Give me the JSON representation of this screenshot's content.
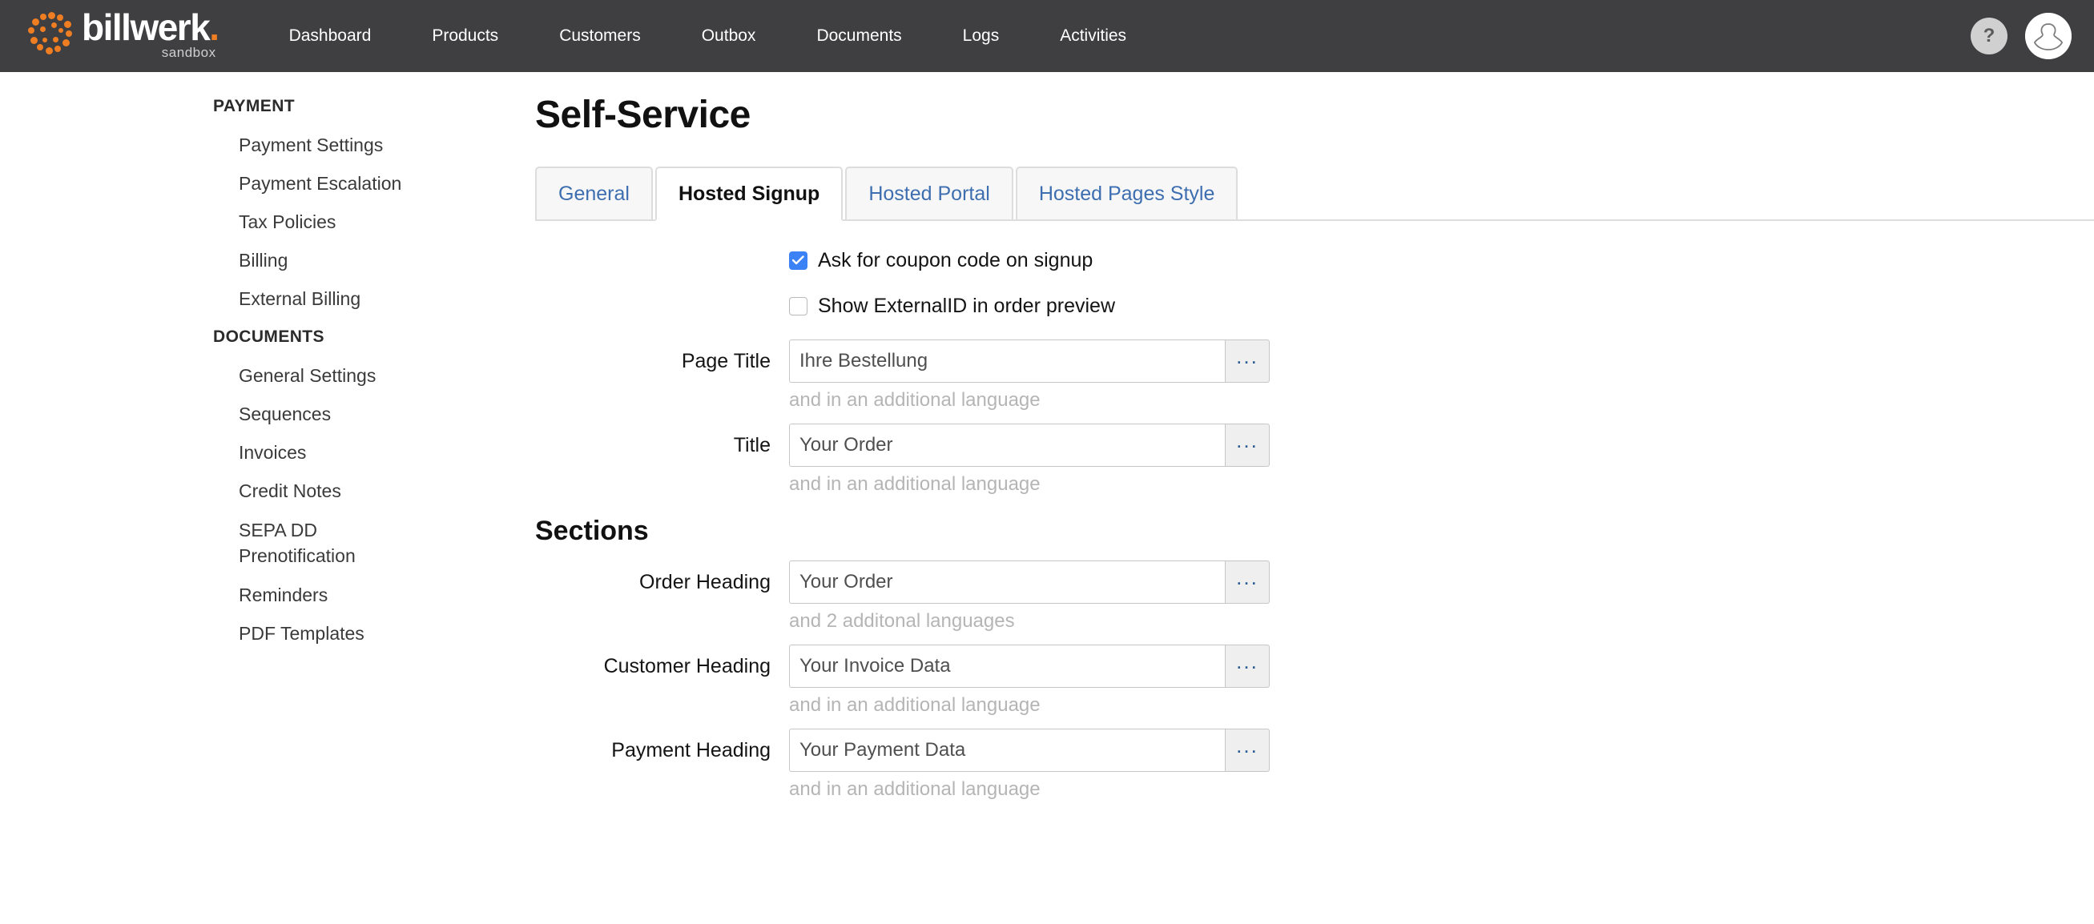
{
  "topbar": {
    "logo": {
      "word": "billwerk",
      "dot": ".",
      "sub": "sandbox"
    },
    "nav": [
      {
        "label": "Dashboard"
      },
      {
        "label": "Products"
      },
      {
        "label": "Customers"
      },
      {
        "label": "Outbox"
      },
      {
        "label": "Documents"
      },
      {
        "label": "Logs"
      },
      {
        "label": "Activities"
      }
    ],
    "help_label": "?",
    "help_icon": "question-mark-icon",
    "avatar_icon": "user-avatar-icon"
  },
  "sidebar": {
    "groups": [
      {
        "title": "PAYMENT",
        "items": [
          {
            "label": "Payment Settings"
          },
          {
            "label": "Payment Escalation"
          },
          {
            "label": "Tax Policies"
          },
          {
            "label": "Billing"
          },
          {
            "label": "External Billing"
          }
        ]
      },
      {
        "title": "DOCUMENTS",
        "items": [
          {
            "label": "General Settings"
          },
          {
            "label": "Sequences"
          },
          {
            "label": "Invoices"
          },
          {
            "label": "Credit Notes"
          },
          {
            "label": "SEPA DD\nPrenotification"
          },
          {
            "label": "Reminders"
          },
          {
            "label": "PDF Templates"
          }
        ]
      }
    ]
  },
  "main": {
    "page_title": "Self-Service",
    "tabs": [
      {
        "label": "General",
        "active": false
      },
      {
        "label": "Hosted Signup",
        "active": true
      },
      {
        "label": "Hosted Portal",
        "active": false
      },
      {
        "label": "Hosted Pages Style",
        "active": false
      }
    ],
    "checkboxes": [
      {
        "label": "Ask for coupon code on signup",
        "checked": true
      },
      {
        "label": "Show ExternalID in order preview",
        "checked": false
      }
    ],
    "fields_top": [
      {
        "label": "Page Title",
        "value": "Ihre Bestellung",
        "helper": "and in an additional language",
        "button_label": "..."
      },
      {
        "label": "Title",
        "value": "Your Order",
        "helper": "and in an additional language",
        "button_label": "..."
      }
    ],
    "sections_heading": "Sections",
    "fields_sections": [
      {
        "label": "Order Heading",
        "value": "Your Order",
        "helper": "and 2 additonal languages",
        "button_label": "..."
      },
      {
        "label": "Customer Heading",
        "value": "Your Invoice Data",
        "helper": "and in an additional language",
        "button_label": "..."
      },
      {
        "label": "Payment Heading",
        "value": "Your Payment Data",
        "helper": "and in an additional language",
        "button_label": "..."
      }
    ]
  },
  "colors": {
    "topbar_bg": "#3f3f41",
    "brand_orange": "#ef7d22",
    "tab_link": "#3d6eb0",
    "checkbox_on": "#3b82f6",
    "helper_text": "#b5b5b5",
    "ellipsis_blue": "#2b5d94"
  }
}
